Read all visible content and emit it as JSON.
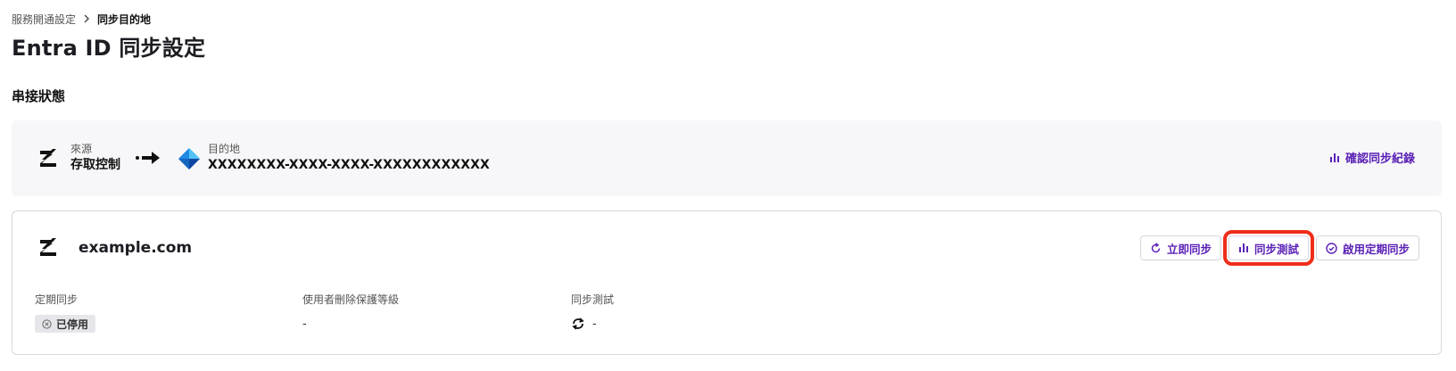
{
  "breadcrumb": {
    "parent": "服務開通設定",
    "current": "同步目的地"
  },
  "page": {
    "title": "Entra ID 同步設定"
  },
  "connection": {
    "section_title": "串接狀態",
    "source": {
      "caption": "來源",
      "value": "存取控制"
    },
    "destination": {
      "caption": "目的地",
      "value": "XXXXXXXX-XXXX-XXXX-XXXXXXXXXXXX"
    },
    "view_log_label": "確認同步紀錄"
  },
  "domain_card": {
    "domain": "example.com",
    "actions": {
      "sync_now": "立即同步",
      "sync_test": "同步測試",
      "enable_schedule": "啟用定期同步"
    },
    "fields": [
      {
        "label": "定期同步",
        "value": "已停用"
      },
      {
        "label": "使用者刪除保護等級",
        "value": "-"
      },
      {
        "label": "同步測試",
        "value": "-"
      }
    ]
  },
  "colors": {
    "accent": "#5b21b6",
    "highlight": "#ef2d1a",
    "panel_bg": "#f7f7f9"
  }
}
